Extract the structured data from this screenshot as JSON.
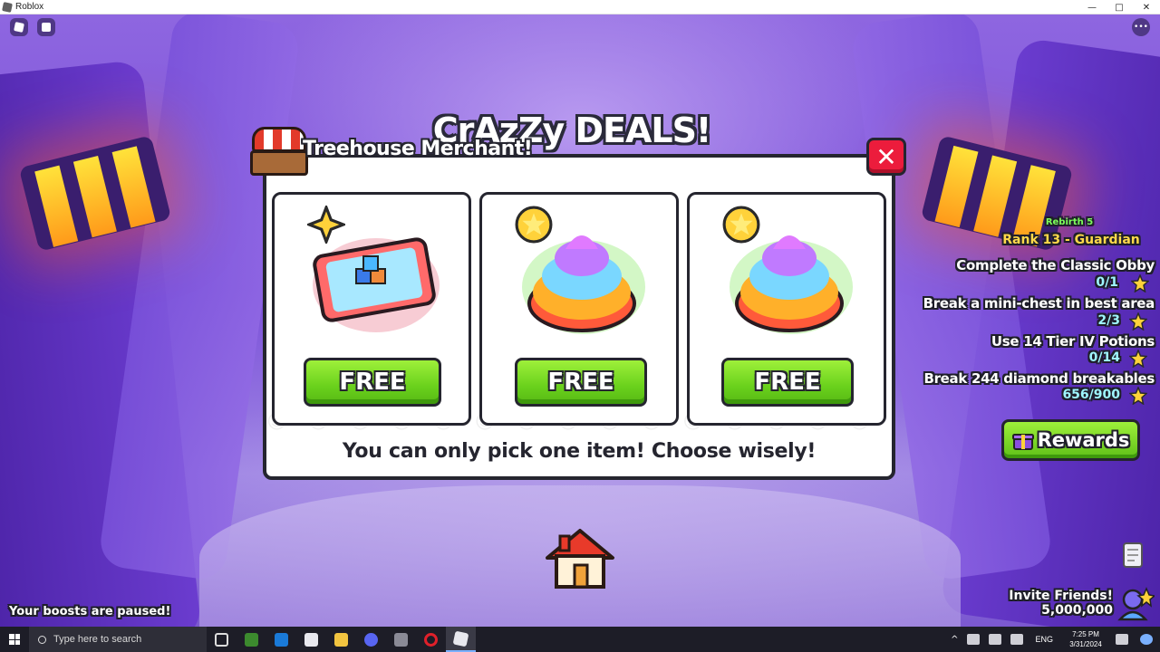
{
  "window": {
    "title": "Roblox",
    "controls": [
      "—",
      "□",
      "✕"
    ]
  },
  "dialog": {
    "title": "CrAzZy DEALS!",
    "merchant": "Treehouse Merchant!",
    "close_label": "✕",
    "items": [
      {
        "icon": "ticket-cubes-icon",
        "button_label": "FREE"
      },
      {
        "icon": "rainbow-swirl-icon",
        "button_label": "FREE"
      },
      {
        "icon": "rainbow-swirl-icon",
        "button_label": "FREE"
      }
    ],
    "hint": "You can only pick one item! Choose wisely!"
  },
  "quests": {
    "rebirth": "Rebirth 5",
    "rank": "Rank 13 - Guardian",
    "list": [
      {
        "title": "Complete the Classic Obby",
        "progress": "0/1"
      },
      {
        "title": "Break a mini-chest in best area",
        "progress": "2/3"
      },
      {
        "title": "Use 14 Tier IV Potions",
        "progress": "0/14"
      },
      {
        "title": "Break 244 diamond breakables",
        "progress": "656/900"
      }
    ]
  },
  "rewards_label": "Rewards",
  "invite": {
    "label": "Invite Friends!",
    "amount": "5,000,000"
  },
  "boosts_notice": "Your boosts are paused!",
  "taskbar": {
    "search_placeholder": "Type here to search",
    "language": "ENG",
    "time": "7:25 PM",
    "date": "3/31/2024"
  },
  "colors": {
    "accent_green": "#6ad11c",
    "close_red": "#ec1c3c",
    "rank_gold": "#ffd94a",
    "rebirth_green": "#7dff5a",
    "progress_cyan": "#9ff6ff"
  }
}
